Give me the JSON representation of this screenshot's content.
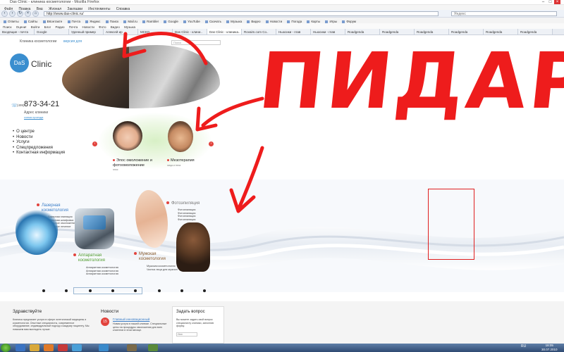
{
  "browser": {
    "title": "Das Clinic - клиника косметологии - Mozilla Firefox",
    "menu": [
      "Файл",
      "Правка",
      "Вид",
      "Журнал",
      "Закладки",
      "Инструменты",
      "Справка"
    ],
    "url": "http://www.das-clinic.ru/",
    "search_placeholder": "Яндекс",
    "bookmarks": [
      "Ответы",
      "Сайты",
      "ВКонтакте",
      "Почта",
      "Яндекс",
      "Поиск",
      "Mail.ru",
      "Rambler",
      "Google",
      "YouTube",
      "Скачать",
      "Музыка",
      "Видео",
      "Новости",
      "Погода",
      "Карты",
      "Игры",
      "Форум"
    ],
    "toolbar2": [
      "Поиск",
      "Оцени!",
      "Войти",
      "Блог",
      "Радио",
      "Почта",
      "Новости",
      "Фото",
      "Видео",
      "Музыка"
    ],
    "tabs": [
      "Входящие - почта",
      "Google",
      "Удачный пример",
      "Алексей ир",
      "МСКО..",
      "Das Clinic - клини..",
      "Das Clinic - клиника..",
      "Rovaim.com Со..",
      "Ньюсики - глав",
      "Ньюсики - глав",
      "Roadgenda",
      "Roadgenda",
      "Roadgenda",
      "Roadgenda",
      "Roadgenda",
      "Roadgenda"
    ],
    "active_tab": 6
  },
  "site": {
    "slogan": "Клиника косметологии",
    "link": "версия для",
    "search_placeholder": "Поиск",
    "logo_mark": "DaS",
    "logo_text": "Clinic",
    "phone_code": "(495)",
    "phone": "873-34-21",
    "address": "Адрес клиники",
    "map_link": "схема проезда",
    "nav": [
      "О центре",
      "Новости",
      "Услуги",
      "Спецпредложения",
      "Контактная информация"
    ]
  },
  "carousel": {
    "items": [
      {
        "title": "Элос омоложение и фотоомоложение",
        "sub": "элос"
      },
      {
        "title": "Мезотерапия",
        "sub": "лица и тела"
      }
    ]
  },
  "services": {
    "laser": {
      "title": "Лазерная косметология",
      "items": [
        "Лазерная эпиляция",
        "Лазерная шлифовка",
        "Лазерное омоложение",
        "Лазерное лечение"
      ]
    },
    "apparatus": {
      "title": "Аппаратная косметология",
      "items": [
        "Аппаратная косметология",
        "Аппаратная косметология",
        "Аппаратная косметология"
      ]
    },
    "photo": {
      "title": "Фотоэпиляция",
      "items": [
        "Фотоэпиляция",
        "Фотоэпиляция",
        "Фотоэпиляция",
        "Фотоэпиляция"
      ]
    },
    "men": {
      "title": "Мужская косметология",
      "items": [
        "Мужская косметология",
        "Чистка лица для мужчин"
      ]
    }
  },
  "bottom": {
    "welcome_title": "Здравствуйте",
    "welcome_text": "Клиника предлагает услуги в сфере эстетической медицины и косметологии. Опытные специалисты, современное оборудование, индивидуальный подход к каждому пациенту. Мы поможем вам выглядеть лучше.",
    "news_title": "Новости",
    "news_badge": "15",
    "news_link": "Главный инновационный",
    "news_text": "Новая услуга в нашей клинике. Специальные цены на процедуры омоложения для всех клиентов в этом месяце.",
    "ask_title": "Задать вопрос",
    "ask_text": "Вы можете задать свой вопрос специалисту клиники, заполнив форму.",
    "ask_input": "Имя"
  },
  "annotation": {
    "text": "ПИДАРЫ",
    "color": "#ee1c1c"
  },
  "taskbar": {
    "lang": "RU",
    "time": "18:05",
    "date": "30.07.2010"
  }
}
